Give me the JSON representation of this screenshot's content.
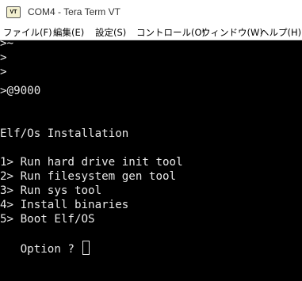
{
  "window": {
    "icon_label": "VT",
    "title": "COM4 - Tera Term VT"
  },
  "menu": {
    "items": [
      {
        "label": "ファイル(F)"
      },
      {
        "label": "編集(E)"
      },
      {
        "label": "設定(S)"
      },
      {
        "label": "コントロール(O)"
      },
      {
        "label": "ウィンドウ(W)"
      },
      {
        "label": "ヘルプ(H)"
      }
    ]
  },
  "terminal": {
    "prompt_lines": [
      ">~",
      ">",
      ">",
      ">@9000"
    ],
    "installer_title": "Elf/Os Installation",
    "options": [
      "1> Run hard drive init tool",
      "2> Run filesystem gen tool",
      "3> Run sys tool",
      "4> Install binaries",
      "5> Boot Elf/OS"
    ],
    "input_prompt": "   Option ? "
  }
}
